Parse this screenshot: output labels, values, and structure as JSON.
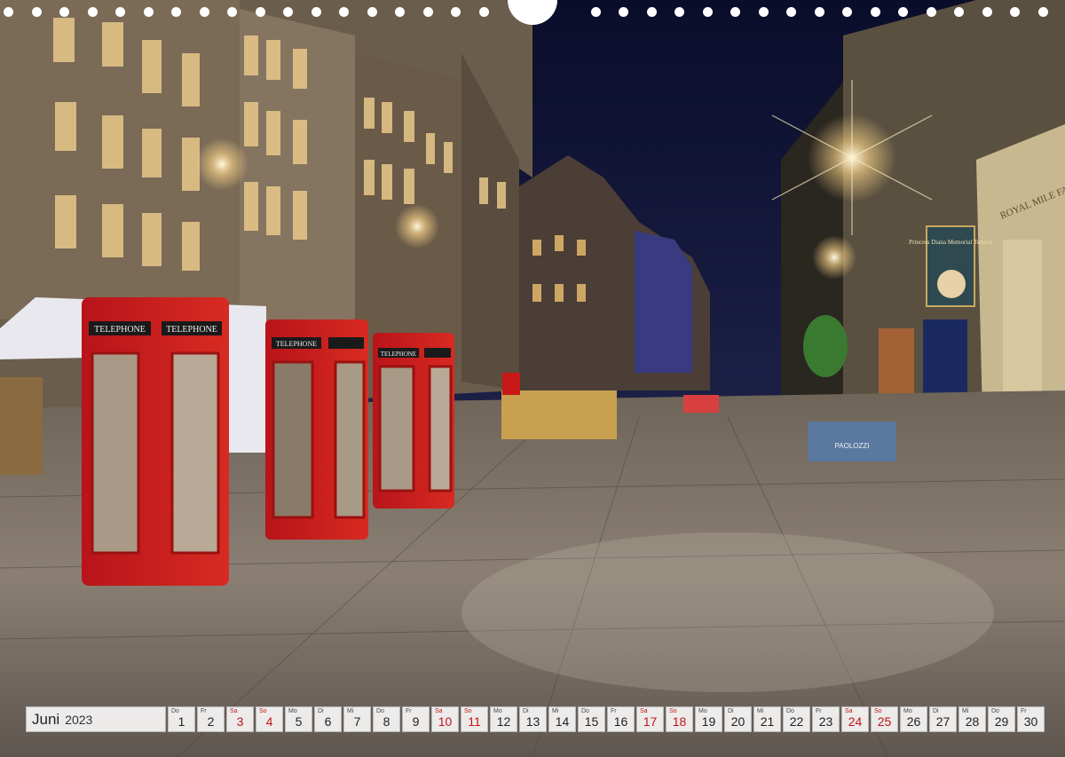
{
  "calendar": {
    "month": "Juni",
    "year": "2023",
    "weekend_color": "#c0141c",
    "days": [
      {
        "wd": "Do",
        "num": "1",
        "weekend": false
      },
      {
        "wd": "Fr",
        "num": "2",
        "weekend": false
      },
      {
        "wd": "Sa",
        "num": "3",
        "weekend": true
      },
      {
        "wd": "So",
        "num": "4",
        "weekend": true
      },
      {
        "wd": "Mo",
        "num": "5",
        "weekend": false
      },
      {
        "wd": "Di",
        "num": "6",
        "weekend": false
      },
      {
        "wd": "Mi",
        "num": "7",
        "weekend": false
      },
      {
        "wd": "Do",
        "num": "8",
        "weekend": false
      },
      {
        "wd": "Fr",
        "num": "9",
        "weekend": false
      },
      {
        "wd": "Sa",
        "num": "10",
        "weekend": true
      },
      {
        "wd": "So",
        "num": "11",
        "weekend": true
      },
      {
        "wd": "Mo",
        "num": "12",
        "weekend": false
      },
      {
        "wd": "Di",
        "num": "13",
        "weekend": false
      },
      {
        "wd": "Mi",
        "num": "14",
        "weekend": false
      },
      {
        "wd": "Do",
        "num": "15",
        "weekend": false
      },
      {
        "wd": "Fr",
        "num": "16",
        "weekend": false
      },
      {
        "wd": "Sa",
        "num": "17",
        "weekend": true
      },
      {
        "wd": "So",
        "num": "18",
        "weekend": true
      },
      {
        "wd": "Mo",
        "num": "19",
        "weekend": false
      },
      {
        "wd": "Di",
        "num": "20",
        "weekend": false
      },
      {
        "wd": "Mi",
        "num": "21",
        "weekend": false
      },
      {
        "wd": "Do",
        "num": "22",
        "weekend": false
      },
      {
        "wd": "Fr",
        "num": "23",
        "weekend": false
      },
      {
        "wd": "Sa",
        "num": "24",
        "weekend": true
      },
      {
        "wd": "So",
        "num": "25",
        "weekend": true
      },
      {
        "wd": "Mo",
        "num": "26",
        "weekend": false
      },
      {
        "wd": "Di",
        "num": "27",
        "weekend": false
      },
      {
        "wd": "Mi",
        "num": "28",
        "weekend": false
      },
      {
        "wd": "Do",
        "num": "29",
        "weekend": false
      },
      {
        "wd": "Fr",
        "num": "30",
        "weekend": false
      }
    ]
  },
  "photo": {
    "booth_sign": "TELEPHONE",
    "shop_sign": "ROYAL MILE FAC",
    "hanging_sign": "Princess Diana Memorial Terrace",
    "barrier_sign": "PAOLOZZI"
  }
}
